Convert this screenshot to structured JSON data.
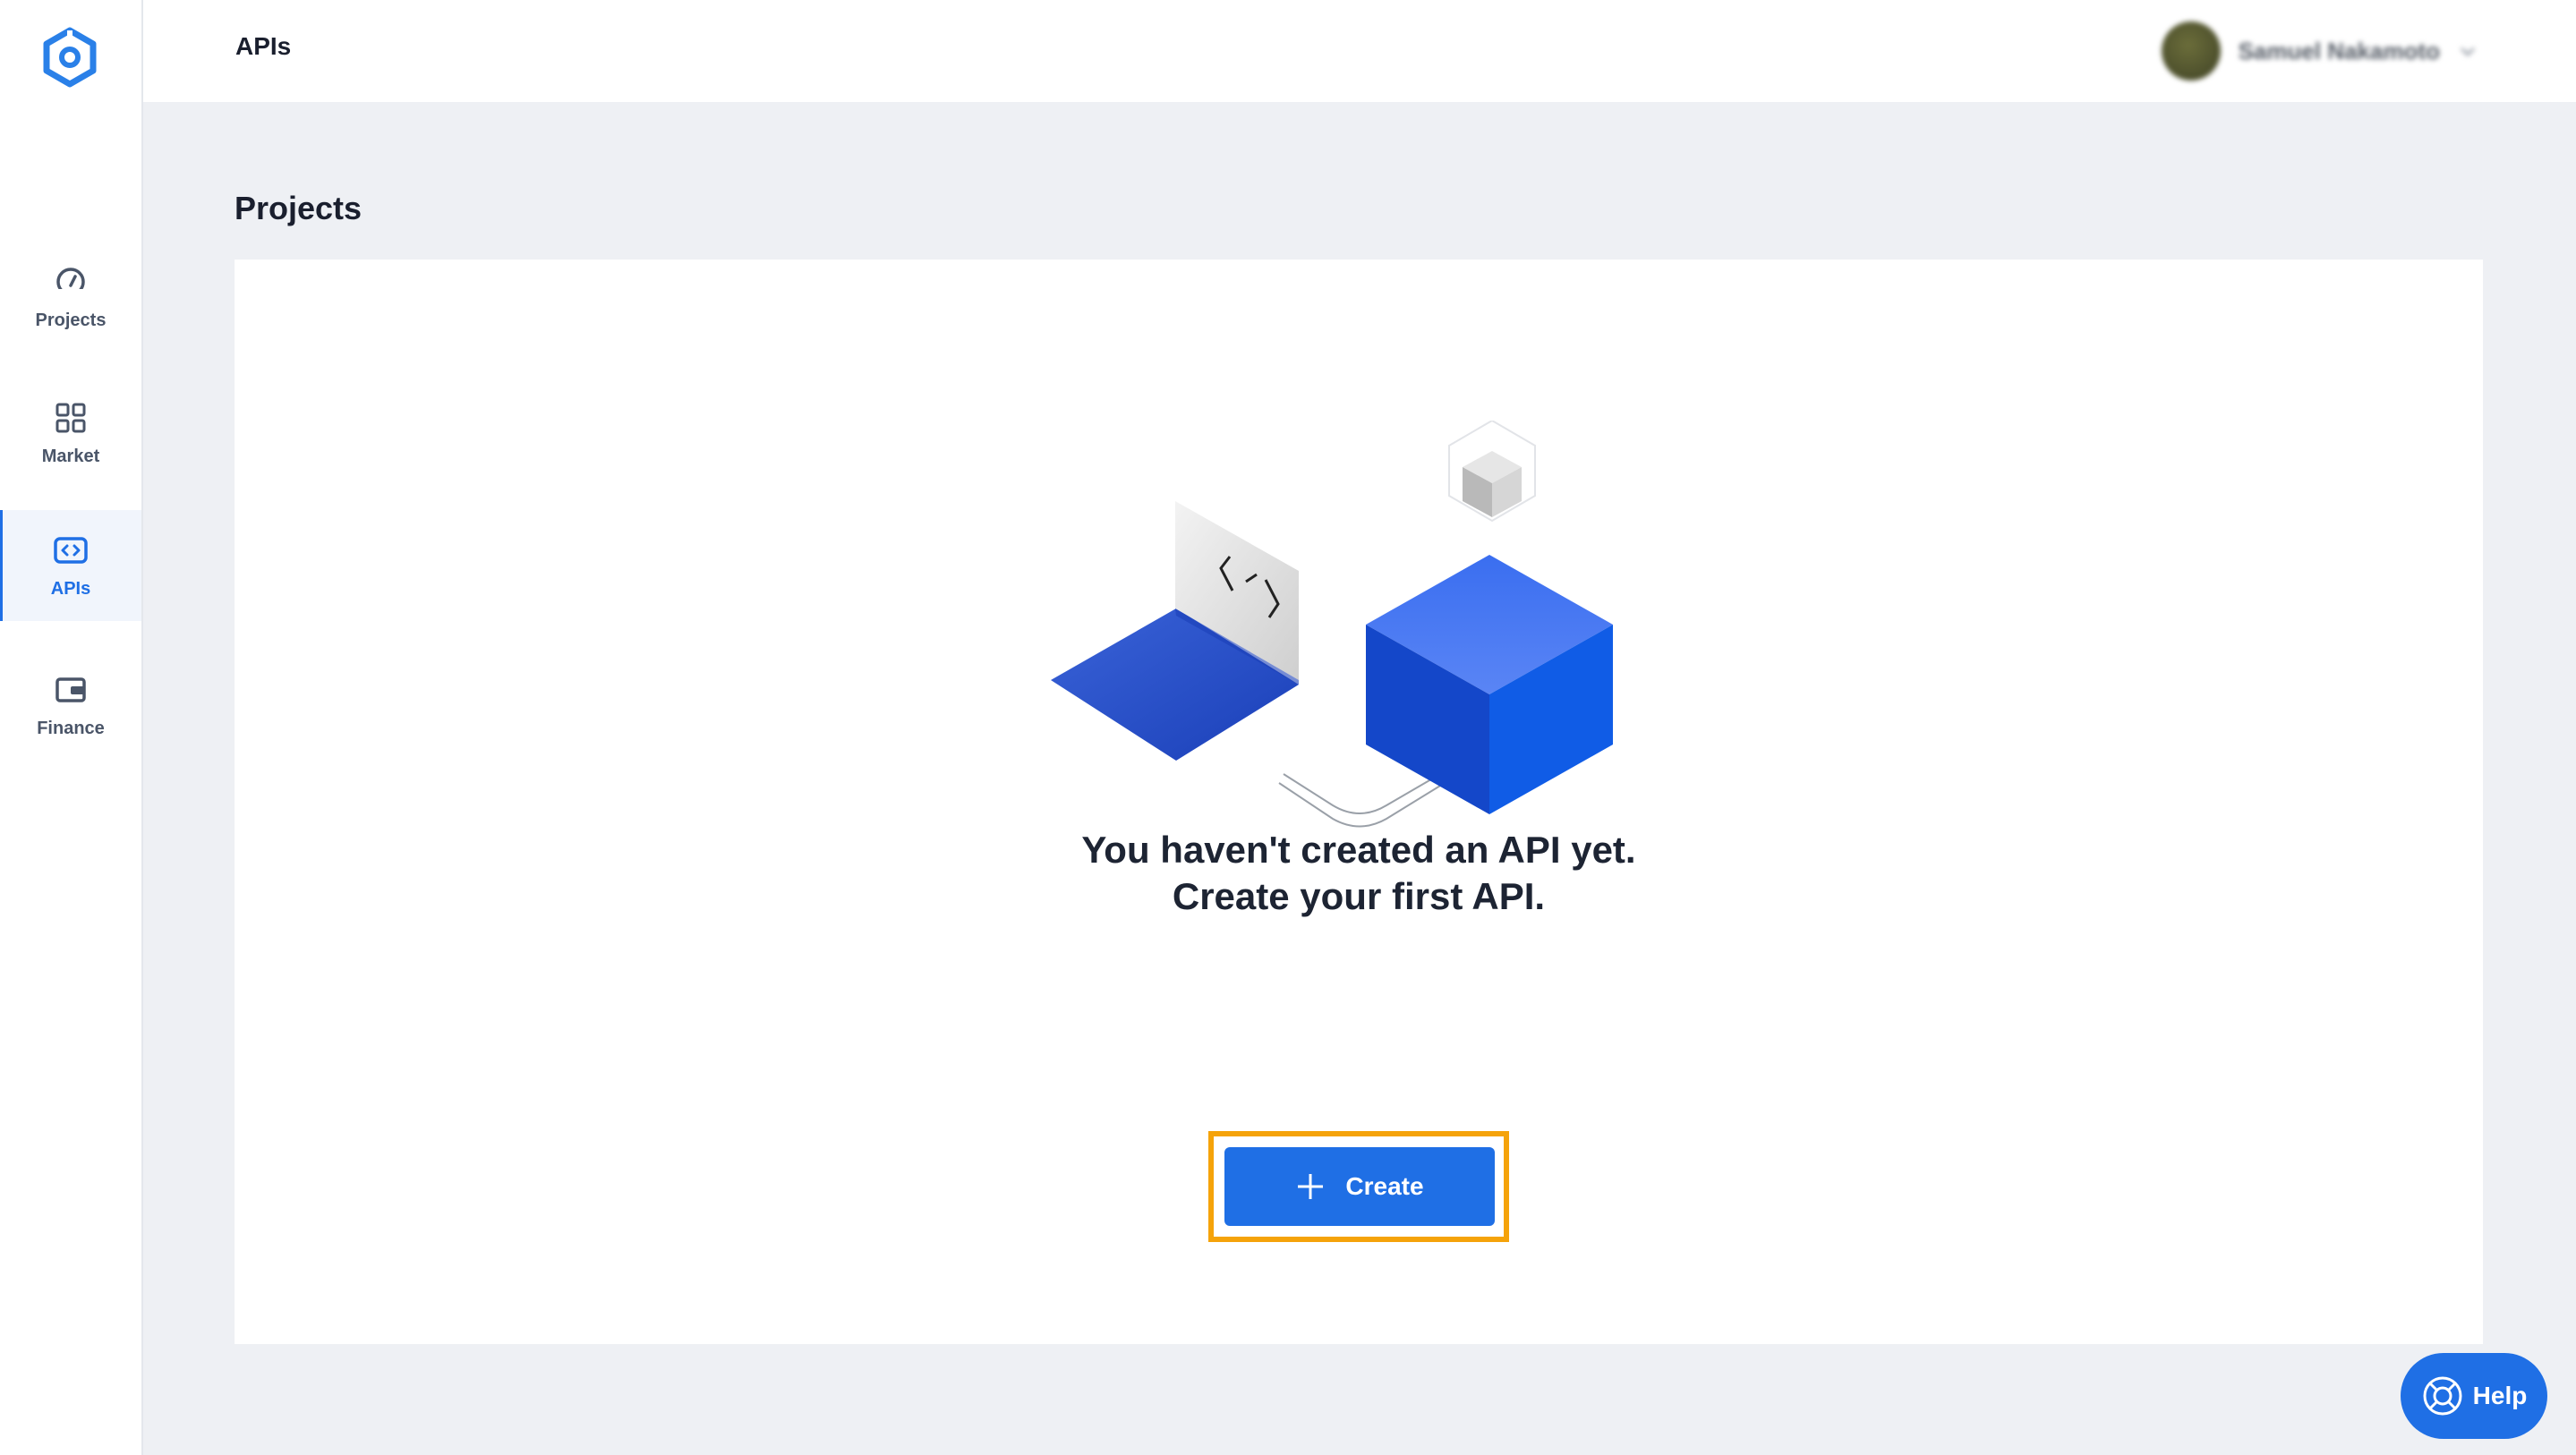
{
  "header": {
    "title": "APIs"
  },
  "user": {
    "name": "Samuel Nakamoto"
  },
  "sidebar": {
    "items": [
      {
        "label": "Projects",
        "icon": "speedometer-icon"
      },
      {
        "label": "Market",
        "icon": "grid-icon"
      },
      {
        "label": "APIs",
        "icon": "code-icon",
        "active": true
      },
      {
        "label": "Finance",
        "icon": "wallet-icon"
      }
    ]
  },
  "main": {
    "heading": "Projects",
    "empty_line1": "You haven't created an API yet.",
    "empty_line2": "Create your first API.",
    "create_label": "Create"
  },
  "help": {
    "label": "Help"
  },
  "colors": {
    "accent": "#1f6fe5",
    "highlight": "#f5a30a",
    "background": "#eef0f4"
  }
}
